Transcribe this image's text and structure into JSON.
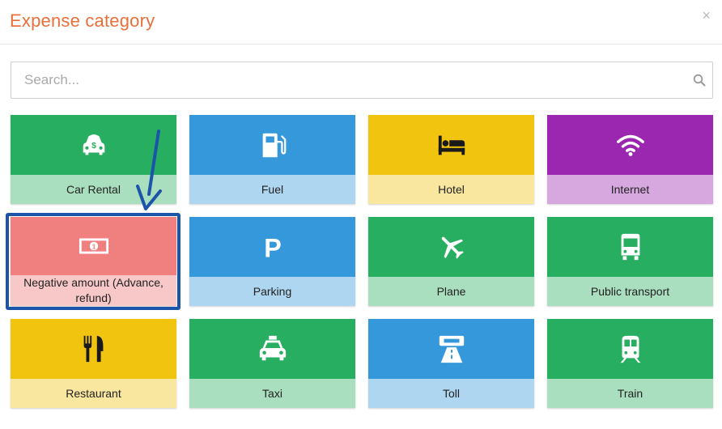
{
  "modal": {
    "title": "Expense category",
    "close_label": "×"
  },
  "search": {
    "placeholder": "Search..."
  },
  "colors": {
    "green": "#27ae60",
    "green_light": "#a9dfbf",
    "blue": "#3498db",
    "blue_light": "#aed6f1",
    "yellow": "#f1c40f",
    "yellow_light": "#f9e79f",
    "purple": "#9b27b0",
    "purple_light": "#d7a8e0",
    "red": "#f08080",
    "red_light": "#f8c8c8",
    "annotation_blue": "#1b54a8",
    "title_orange": "#e8703a"
  },
  "categories": [
    {
      "label": "Car Rental",
      "icon": "car-rental-icon",
      "color": "green"
    },
    {
      "label": "Fuel",
      "icon": "fuel-pump-icon",
      "color": "blue"
    },
    {
      "label": "Hotel",
      "icon": "bed-icon",
      "color": "yellow"
    },
    {
      "label": "Internet",
      "icon": "wifi-icon",
      "color": "purple"
    },
    {
      "label": "Negative amount (Advance, refund)",
      "icon": "money-bill-icon",
      "color": "red"
    },
    {
      "label": "Parking",
      "icon": "parking-icon",
      "color": "blue"
    },
    {
      "label": "Plane",
      "icon": "plane-icon",
      "color": "green"
    },
    {
      "label": "Public transport",
      "icon": "bus-icon",
      "color": "green"
    },
    {
      "label": "Restaurant",
      "icon": "utensils-icon",
      "color": "yellow"
    },
    {
      "label": "Taxi",
      "icon": "taxi-icon",
      "color": "green"
    },
    {
      "label": "Toll",
      "icon": "toll-road-icon",
      "color": "blue"
    },
    {
      "label": "Train",
      "icon": "train-icon",
      "color": "green"
    }
  ]
}
